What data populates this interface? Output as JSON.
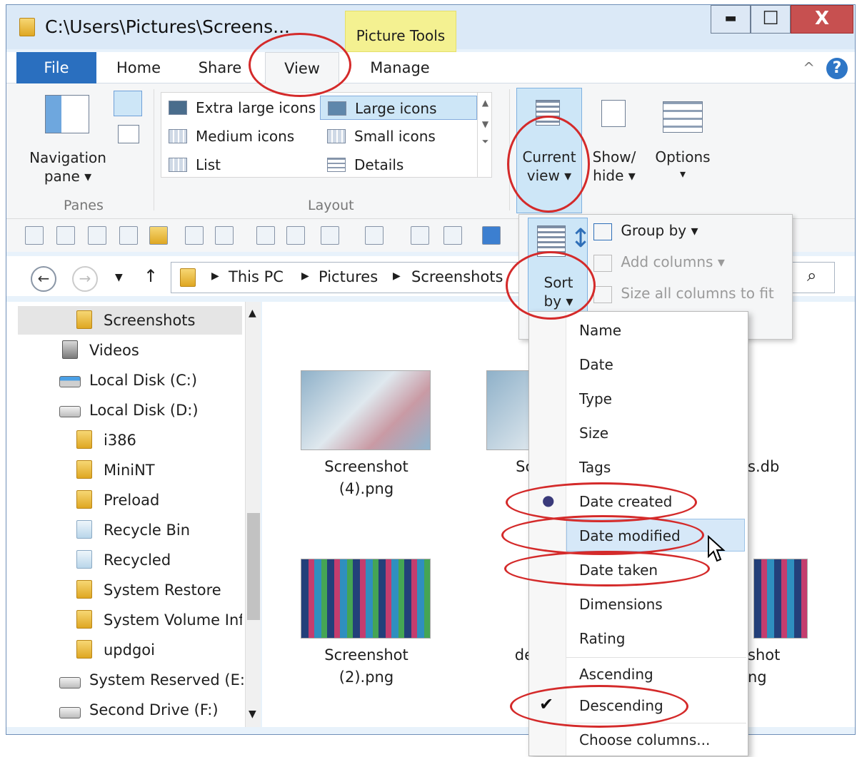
{
  "window": {
    "title": "C:\\Users\\Pictures\\Screens...",
    "contextual_tab": "Picture Tools",
    "controls": {
      "minimize": "▬",
      "maximize": "☐",
      "close": "X"
    }
  },
  "tabs": [
    {
      "label": "File"
    },
    {
      "label": "Home"
    },
    {
      "label": "Share"
    },
    {
      "label": "View"
    },
    {
      "label": "Manage"
    }
  ],
  "ribbon": {
    "panes": {
      "nav_pane_line1": "Navigation",
      "nav_pane_line2": "pane ▾",
      "group": "Panes"
    },
    "layout": {
      "group": "Layout",
      "items": [
        "Extra large icons",
        "Large icons",
        "Medium icons",
        "Small icons",
        "List",
        "Details"
      ],
      "selected": "Large icons"
    },
    "current_view": {
      "line1": "Current",
      "line2": "view ▾"
    },
    "show_hide": {
      "line1": "Show/",
      "line2": "hide ▾"
    },
    "options": {
      "label": "Options",
      "arrow": "▾"
    }
  },
  "current_view_panel": {
    "sort_by": {
      "line1": "Sort",
      "line2": "by ▾"
    },
    "group_by": "Group by ▾",
    "add_columns": "Add columns ▾",
    "size_columns": "Size all columns to fit"
  },
  "address": {
    "crumbs": [
      "This PC",
      "Pictures",
      "Screenshots"
    ],
    "search_icon": "⌕"
  },
  "nav_pane": {
    "items": [
      {
        "label": "Screenshots",
        "icon": "folder-icon"
      },
      {
        "label": "Videos",
        "icon": "videos-icon"
      },
      {
        "label": "Local Disk (C:)",
        "icon": "drive-icon"
      },
      {
        "label": "Local Disk (D:)",
        "icon": "drive-icon"
      },
      {
        "label": "i386",
        "icon": "folder-icon"
      },
      {
        "label": "MiniNT",
        "icon": "folder-icon"
      },
      {
        "label": "Preload",
        "icon": "folder-icon"
      },
      {
        "label": "Recycle Bin",
        "icon": "recycle-bin-icon"
      },
      {
        "label": "Recycled",
        "icon": "recycle-bin-icon"
      },
      {
        "label": "System Restore",
        "icon": "folder-icon"
      },
      {
        "label": "System Volume Inf",
        "icon": "folder-icon"
      },
      {
        "label": "updgoi",
        "icon": "folder-icon"
      },
      {
        "label": "System Reserved (E:)",
        "icon": "drive-icon"
      },
      {
        "label": "Second Drive (F:)",
        "icon": "drive-icon"
      }
    ],
    "selected": "Screenshots"
  },
  "files": {
    "f1": {
      "line1": "Screenshot",
      "line2": "(4).png"
    },
    "f2": {
      "line1": "Sc"
    },
    "f3": {
      "line1": "s.db"
    },
    "f4": {
      "line1": "Screenshot",
      "line2": "(2).png"
    },
    "f5": {
      "line1": "de"
    },
    "f6": {
      "line1": "shot",
      "line2": "ng"
    }
  },
  "sort_menu": {
    "items": [
      "Name",
      "Date",
      "Type",
      "Size",
      "Tags",
      "Date created",
      "Date modified",
      "Date taken",
      "Dimensions",
      "Rating"
    ],
    "order": [
      "Ascending",
      "Descending"
    ],
    "choose_columns": "Choose columns...",
    "selected_sort": "Date created",
    "selected_order": "Descending",
    "hovered": "Date modified",
    "radio_glyph": "●",
    "check_glyph": "✔"
  },
  "colors": {
    "accent_file_tab": "#2a6fbf",
    "contextual_tab": "#f4f191",
    "selection": "#cde6f7",
    "annotation": "#d42a2a"
  }
}
